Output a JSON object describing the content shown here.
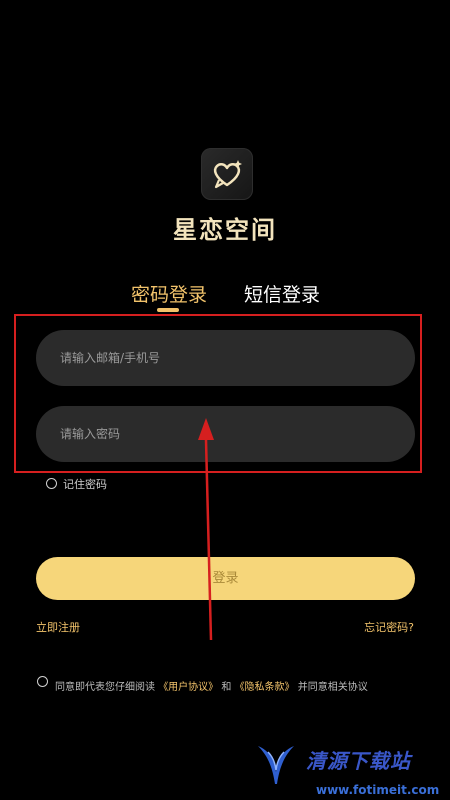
{
  "app": {
    "title": "星恋空间"
  },
  "tabs": [
    {
      "label": "密码登录",
      "active": true
    },
    {
      "label": "短信登录",
      "active": false
    }
  ],
  "form": {
    "email_placeholder": "请输入邮箱/手机号",
    "password_placeholder": "请输入密码",
    "remember_label": "记住密码",
    "login_label": "登录",
    "register_label": "立即注册",
    "forgot_label": "忘记密码?"
  },
  "agreement": {
    "prefix": "同意即代表您仔细阅读",
    "user_agreement": "《用户协议》",
    "and": "和",
    "privacy_policy": "《隐私条款》",
    "suffix": "并同意相关协议"
  },
  "watermark": {
    "title": "清源下载站",
    "url": "www.fotimeit.com"
  },
  "colors": {
    "accent": "#f2c36b",
    "button": "#f6d67a",
    "field": "#2b2b2b",
    "annotation": "#d61f1f"
  },
  "icons": {
    "logo": "heart-speech-bubble-icon"
  }
}
